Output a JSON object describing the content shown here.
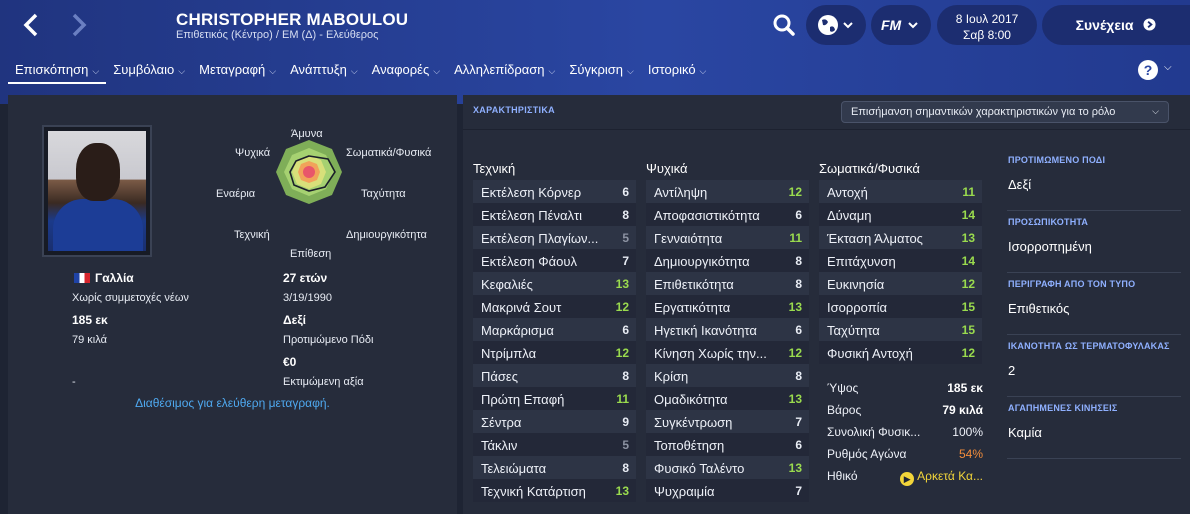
{
  "header": {
    "player_name": "CHRISTOPHER MABOULOU",
    "player_subtitle": "Επιθετικός (Κέντρο) / ΕΜ (Δ) - Ελεύθερος",
    "date_line1": "8 Ιουλ 2017",
    "date_line2": "Σαβ 8:00",
    "continue_label": "Συνέχεια",
    "fm_label": "FM"
  },
  "tabs": [
    {
      "label": "Επισκόπηση"
    },
    {
      "label": "Συμβόλαιο"
    },
    {
      "label": "Μεταγραφή"
    },
    {
      "label": "Ανάπτυξη"
    },
    {
      "label": "Αναφορές"
    },
    {
      "label": "Αλληλεπίδραση"
    },
    {
      "label": "Σύγκριση"
    },
    {
      "label": "Ιστορικό"
    }
  ],
  "help_label": "?",
  "radar": {
    "labels": {
      "top": "Άμυνα",
      "top_right": "Σωματικά/Φυσικά",
      "right": "Ταχύτητα",
      "bottom_right": "Δημιουργικότητα",
      "bottom": "Επίθεση",
      "bottom_left": "Τεχνική",
      "left": "Εναέρια",
      "top_left": "Ψυχικά"
    }
  },
  "bio": {
    "nation": "Γαλλία",
    "youth_caps": "Χωρίς συμμετοχές νέων",
    "age": "27 ετών",
    "dob": "3/19/1990",
    "height": "185 εκ",
    "weight": "79 κιλά",
    "foot": "Δεξί",
    "foot_label": "Προτιμώμενο Πόδι",
    "value": "€0",
    "value_label": "Εκτιμώμενη αξία",
    "dash": "-",
    "free_transfer": "Διαθέσιμος για ελεύθερη μεταγραφή."
  },
  "attributes": {
    "section_title": "ΧΑΡΑΚΤΗΡΙΣΤΙΚΑ",
    "highlight_dropdown": "Επισήμανση σημαντικών χαρακτηριστικών για το ρόλο",
    "technical_title": "Τεχνική",
    "mental_title": "Ψυχικά",
    "physical_title": "Σωματικά/Φυσικά",
    "technical": [
      {
        "name": "Εκτέλεση Κόρνερ",
        "value": "6",
        "lvl": "mid"
      },
      {
        "name": "Εκτέλεση Πέναλτι",
        "value": "8",
        "lvl": "mid"
      },
      {
        "name": "Εκτέλεση Πλαγίων...",
        "value": "5",
        "lvl": "lo"
      },
      {
        "name": "Εκτέλεση Φάουλ",
        "value": "7",
        "lvl": "mid"
      },
      {
        "name": "Κεφαλιές",
        "value": "13",
        "lvl": "hi"
      },
      {
        "name": "Μακρινά Σουτ",
        "value": "12",
        "lvl": "hi"
      },
      {
        "name": "Μαρκάρισμα",
        "value": "6",
        "lvl": "mid"
      },
      {
        "name": "Ντρίμπλα",
        "value": "12",
        "lvl": "hi"
      },
      {
        "name": "Πάσες",
        "value": "8",
        "lvl": "mid"
      },
      {
        "name": "Πρώτη Επαφή",
        "value": "11",
        "lvl": "hi"
      },
      {
        "name": "Σέντρα",
        "value": "9",
        "lvl": "mid"
      },
      {
        "name": "Τάκλιν",
        "value": "5",
        "lvl": "lo"
      },
      {
        "name": "Τελειώματα",
        "value": "8",
        "lvl": "mid"
      },
      {
        "name": "Τεχνική Κατάρτιση",
        "value": "13",
        "lvl": "hi"
      }
    ],
    "mental": [
      {
        "name": "Αντίληψη",
        "value": "12",
        "lvl": "hi"
      },
      {
        "name": "Αποφασιστικότητα",
        "value": "6",
        "lvl": "mid"
      },
      {
        "name": "Γενναιότητα",
        "value": "11",
        "lvl": "hi"
      },
      {
        "name": "Δημιουργικότητα",
        "value": "8",
        "lvl": "mid"
      },
      {
        "name": "Επιθετικότητα",
        "value": "8",
        "lvl": "mid"
      },
      {
        "name": "Εργατικότητα",
        "value": "13",
        "lvl": "hi"
      },
      {
        "name": "Ηγετική Ικανότητα",
        "value": "6",
        "lvl": "mid"
      },
      {
        "name": "Κίνηση Χωρίς την...",
        "value": "12",
        "lvl": "hi"
      },
      {
        "name": "Κρίση",
        "value": "8",
        "lvl": "mid"
      },
      {
        "name": "Ομαδικότητα",
        "value": "13",
        "lvl": "hi"
      },
      {
        "name": "Συγκέντρωση",
        "value": "7",
        "lvl": "mid"
      },
      {
        "name": "Τοποθέτηση",
        "value": "6",
        "lvl": "mid"
      },
      {
        "name": "Φυσικό Ταλέντο",
        "value": "13",
        "lvl": "hi"
      },
      {
        "name": "Ψυχραιμία",
        "value": "7",
        "lvl": "mid"
      }
    ],
    "physical": [
      {
        "name": "Αντοχή",
        "value": "11",
        "lvl": "hi"
      },
      {
        "name": "Δύναμη",
        "value": "14",
        "lvl": "hi"
      },
      {
        "name": "Έκταση Άλματος",
        "value": "13",
        "lvl": "hi"
      },
      {
        "name": "Επιτάχυνση",
        "value": "14",
        "lvl": "hi"
      },
      {
        "name": "Ευκινησία",
        "value": "12",
        "lvl": "hi"
      },
      {
        "name": "Ισορροπία",
        "value": "15",
        "lvl": "hi"
      },
      {
        "name": "Ταχύτητα",
        "value": "15",
        "lvl": "hi"
      },
      {
        "name": "Φυσική Αντοχή",
        "value": "12",
        "lvl": "hi"
      }
    ],
    "physical_extra": [
      {
        "name": "Ύψος",
        "value": "185 εκ",
        "style": "bold"
      },
      {
        "name": "Βάρος",
        "value": "79 κιλά",
        "style": "bold"
      },
      {
        "name": "Συνολική Φυσικ...",
        "value": "100%",
        "style": "plain"
      },
      {
        "name": "Ρυθμός Αγώνα",
        "value": "54%",
        "style": "orange"
      },
      {
        "name": "Ηθικό",
        "value": "Αρκετά Κα...",
        "style": "yellow"
      }
    ]
  },
  "side": [
    {
      "head": "ΠΡΟΤΙΜΩΜΕΝΟ ΠΟΔΙ",
      "value": "Δεξί"
    },
    {
      "head": "ΠΡΟΣΩΠΙΚΟΤΗΤΑ",
      "value": "Ισορροπημένη"
    },
    {
      "head": "ΠΕΡΙΓΡΑΦΗ ΑΠΟ ΤΟΝ ΤΥΠΟ",
      "value": "Επιθετικός"
    },
    {
      "head": "ΙΚΑΝΟΤΗΤΑ ΩΣ ΤΕΡΜΑΤΟΦΥΛΑΚΑΣ",
      "value": "2"
    },
    {
      "head": "ΑΓΑΠΗΜΕΝΕΣ ΚΙΝΗΣΕΙΣ",
      "value": "Καμία"
    }
  ]
}
